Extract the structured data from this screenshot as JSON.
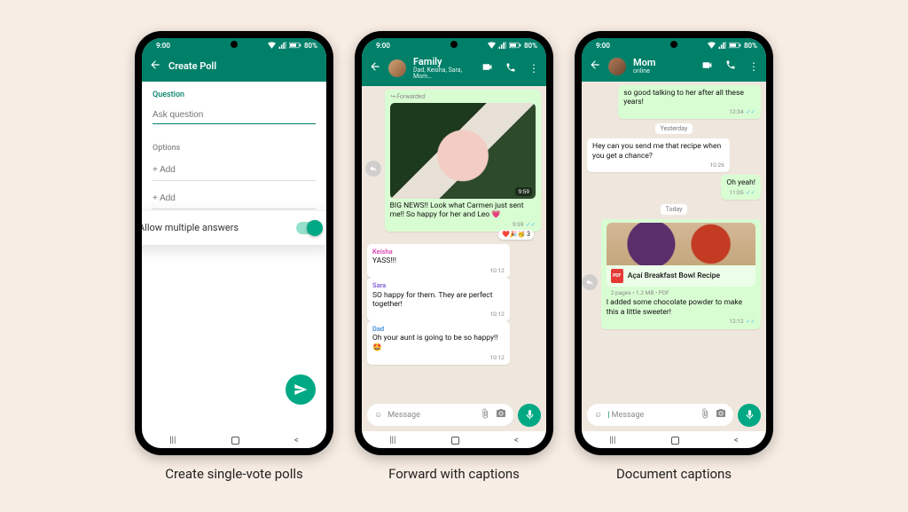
{
  "status": {
    "time": "9:00",
    "battery": "80%"
  },
  "captions": [
    "Create single-vote polls",
    "Forward with captions",
    "Document captions"
  ],
  "poll": {
    "screen_title": "Create Poll",
    "question_label": "Question",
    "question_placeholder": "Ask question",
    "options_label": "Options",
    "option_add": "+ Add",
    "toggle_label": "Allow multiple answers"
  },
  "family": {
    "title": "Family",
    "subtitle": "Dad, Keisha, Sara, Mom…",
    "forwarded": "Forwarded",
    "img_time": "9:59",
    "caption_msg": "BIG NEWS!! Look what Carmen just sent me!! So happy for her and Leo 💗",
    "caption_time": "9:59",
    "reactions": "❤️🎉🥳 3",
    "replies": [
      {
        "sender": "Keisha",
        "cls": "senderK",
        "text": "YASS!!!",
        "time": "10:12"
      },
      {
        "sender": "Sara",
        "cls": "senderS",
        "text": "SO happy for them. They are perfect together!",
        "time": "10:12"
      },
      {
        "sender": "Dad",
        "cls": "senderD",
        "text": "Oh your aunt is going to be so happy!! 🤩",
        "time": "10:12"
      }
    ]
  },
  "mom": {
    "title": "Mom",
    "subtitle": "online",
    "msg1": "so good talking to her after all these years!",
    "msg1_time": "12:34",
    "chip_yesterday": "Yesterday",
    "msg2": "Hey can you send me that recipe when you get a chance?",
    "msg2_time": "10:26",
    "msg3": "Oh yeah!",
    "msg3_time": "11:05",
    "chip_today": "Today",
    "doc_title": "Açaí Breakfast Bowl Recipe",
    "doc_meta": "2 pages • 1.2 MB • PDF",
    "doc_icon": "PDF",
    "doc_caption": "I added some chocolate powder to make this a little sweeter!",
    "doc_time": "12:12"
  },
  "input": {
    "placeholder": "Message"
  }
}
